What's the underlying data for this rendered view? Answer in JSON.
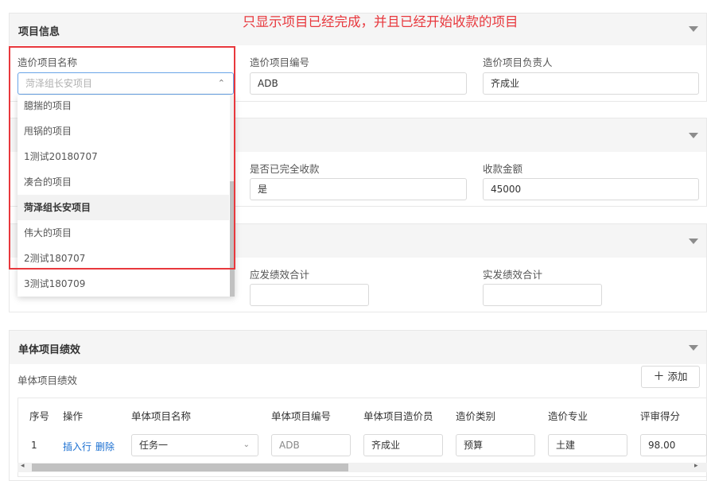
{
  "notice": "只显示项目已经完成，并且已经开始收款的项目",
  "section1": {
    "title": "项目信息",
    "fields": {
      "name_label": "造价项目名称",
      "name_placeholder": "菏泽组长安项目",
      "code_label": "造价项目编号",
      "code_value": "ADB",
      "owner_label": "造价项目负责人",
      "owner_value": "齐成业"
    },
    "dropdown_options": [
      "臆揣的项目",
      "甩锅的项目",
      "1测试20180707",
      "凑合的项目",
      "菏泽组长安项目",
      "伟大的项目",
      "2测试180707",
      "3测试180709"
    ],
    "selected_option": "菏泽组长安项目"
  },
  "section2": {
    "paid_label": "是否已完全收款",
    "paid_value": "是",
    "amount_label": "收款金额",
    "amount_value": "45000"
  },
  "section3": {
    "due_label": "应发绩效合计",
    "due_value": "",
    "actual_label": "实发绩效合计",
    "actual_value": ""
  },
  "section4": {
    "title": "单体项目绩效",
    "subtitle": "单体项目绩效",
    "add_label": "添加",
    "columns": [
      "序号",
      "操作",
      "单体项目名称",
      "单体项目编号",
      "单体项目造价员",
      "造价类别",
      "造价专业",
      "评审得分"
    ],
    "row": {
      "index": "1",
      "insert_label": "插入行",
      "delete_label": "删除",
      "name": "任务一",
      "code": "ADB",
      "staff": "齐成业",
      "category": "预算",
      "major": "土建",
      "score": "98.00"
    }
  }
}
